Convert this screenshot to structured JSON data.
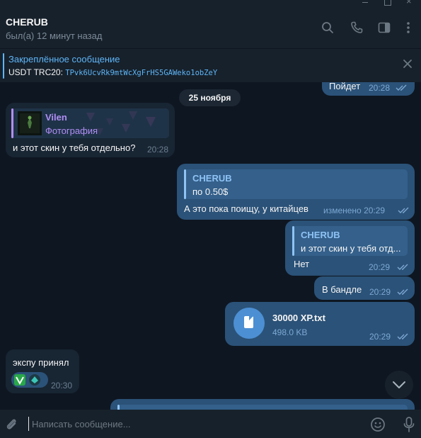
{
  "header": {
    "chat_name": "CHERUB",
    "status": "был(а) 12 минут назад"
  },
  "pinned": {
    "title": "Закреплённое сообщение",
    "text_prefix": "USDT TRC20: ",
    "address": "TPvk6UcvRk9mtWcXgFrHS5GAWeko1obZeY"
  },
  "messages": {
    "top_partial": {
      "text": "Пойдет",
      "time": "20:28"
    },
    "date_chip": "25 ноября",
    "msg1": {
      "reply_name": "Vilen",
      "reply_text": "Фотография",
      "text": "и этот скин у тебя отдельно?",
      "time": "20:28"
    },
    "msg2": {
      "reply_name": "CHERUB",
      "reply_text": "по 0.50$",
      "text": "А это пока поищу, у китайцев",
      "time": "изменено 20:29"
    },
    "msg3": {
      "reply_name": "CHERUB",
      "reply_text": "и этот скин у тебя отд...",
      "text": "Нет",
      "time": "20:29"
    },
    "msg4": {
      "text": "В бандле",
      "time": "20:29"
    },
    "msg5": {
      "file_name": "30000 XP.txt",
      "file_size": "498.0 KB",
      "time": "20:29"
    },
    "msg6": {
      "text": "экспу принял",
      "time": "20:30"
    }
  },
  "composer": {
    "placeholder": "Написать сообщение..."
  },
  "icons": [
    "minimize-icon",
    "maximize-icon",
    "close-window-icon",
    "search-icon",
    "phone-icon",
    "sidebar-toggle-icon",
    "more-vert-icon",
    "close-icon",
    "double-check-icon",
    "file-icon",
    "chevron-down-icon",
    "paperclip-icon",
    "emoji-icon",
    "microphone-icon"
  ],
  "colors": {
    "background": "#0e1621",
    "panel": "#17212b",
    "incoming": "#182533",
    "outgoing": "#2b5278",
    "accent": "#5eb5f7",
    "reply_name_incoming": "#b18ef5"
  }
}
